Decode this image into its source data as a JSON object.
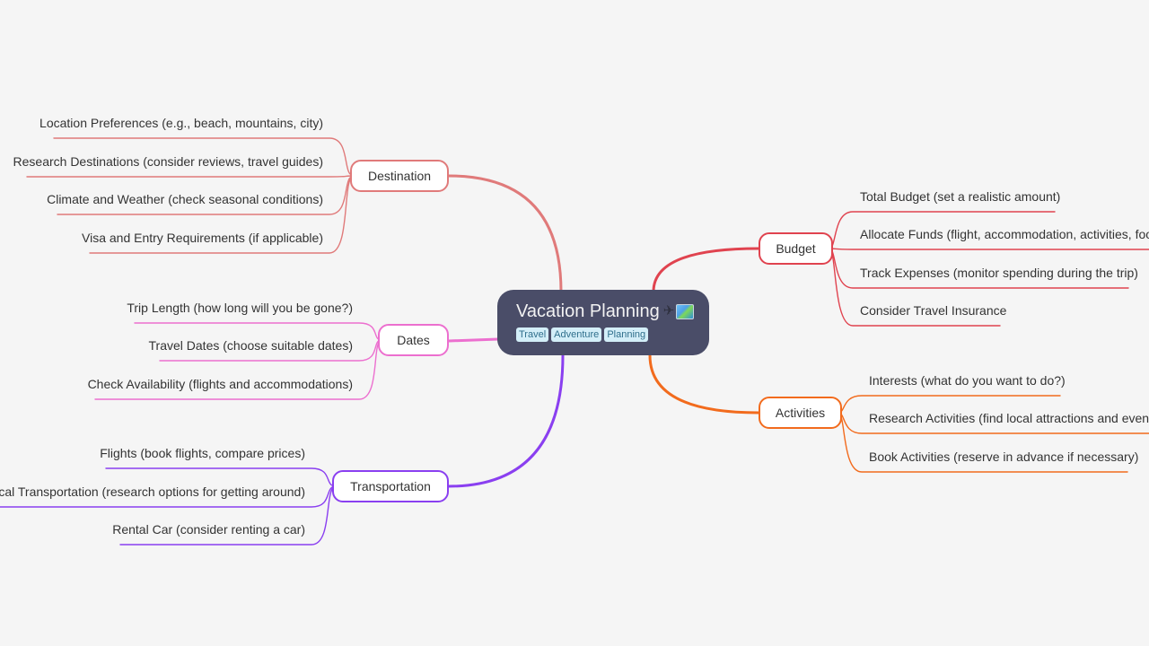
{
  "root": {
    "title": "Vacation Planning",
    "emoji_icons": [
      "airplane-icon",
      "world-map-icon"
    ],
    "plane_glyph": "✈",
    "tags": [
      "Travel",
      "Adventure",
      "Planning"
    ]
  },
  "branches": [
    {
      "id": "destination",
      "label": "Destination",
      "side": "left",
      "color": "#e07a7a",
      "children": [
        "Location Preferences (e.g., beach, mountains, city)",
        "Research Destinations (consider reviews, travel guides)",
        "Climate and Weather (check seasonal conditions)",
        "Visa and Entry Requirements (if applicable)"
      ]
    },
    {
      "id": "dates",
      "label": "Dates",
      "side": "left",
      "color": "#ec6fcf",
      "children": [
        "Trip Length (how long will you be gone?)",
        "Travel Dates (choose suitable dates)",
        "Check Availability (flights and accommodations)"
      ]
    },
    {
      "id": "transportation",
      "label": "Transportation",
      "side": "left",
      "color": "#8a3ff0",
      "children": [
        "Flights (book flights, compare prices)",
        "Local Transportation (research options for getting around)",
        "Rental Car (consider renting a car)"
      ]
    },
    {
      "id": "budget",
      "label": "Budget",
      "side": "right",
      "color": "#e0434f",
      "children": [
        "Total Budget (set a realistic amount)",
        "Allocate Funds (flight, accommodation, activities, food)",
        "Track Expenses (monitor spending during the trip)",
        "Consider Travel Insurance"
      ]
    },
    {
      "id": "activities",
      "label": "Activities",
      "side": "right",
      "color": "#f26b1d",
      "children": [
        "Interests (what do you want to do?)",
        "Research Activities (find local attractions and events)",
        "Book Activities (reserve in advance if necessary)"
      ]
    }
  ]
}
